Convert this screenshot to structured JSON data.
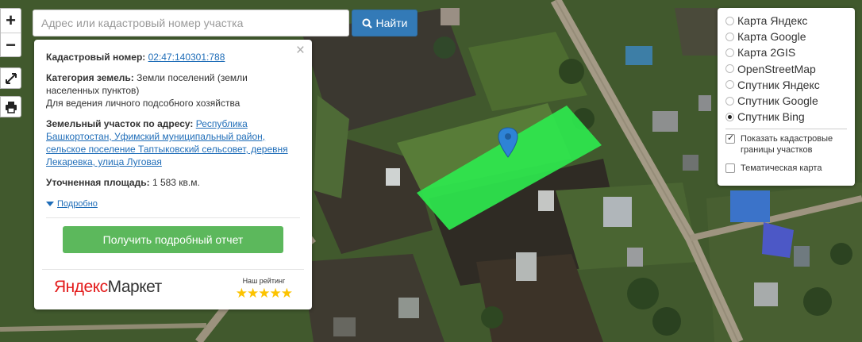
{
  "map": {
    "marker": "map-marker-icon",
    "plot_color": "#2ee84e"
  },
  "controls": {
    "zoom_in": "+",
    "zoom_out": "−",
    "fullscreen_icon": "fullscreen-icon",
    "print_icon": "print-icon"
  },
  "search": {
    "placeholder": "Адрес или кадастровый номер участка",
    "button_label": "Найти",
    "button_icon": "search-icon"
  },
  "info": {
    "cadastral_label": "Кадастровый номер:",
    "cadastral_number": "02:47:140301:788",
    "category_label": "Категория земель:",
    "category_value": "Земли поселений (земли населенных пунктов)",
    "usage": "Для ведения личного подсобного хозяйства",
    "address_label": "Земельный участок по адресу:",
    "address_value": "Республика Башкортостан, Уфимский муниципальный район, сельское поселение Таптыковский сельсовет, деревня Лекаревка, улица Луговая",
    "area_label": "Уточненная площадь:",
    "area_value": "1 583 кв.м.",
    "details_link": "Подробно",
    "report_button": "Получить подробный отчет",
    "market_logo_ya": "Яндекс",
    "market_logo_rest": "Маркет",
    "rating_label": "Наш рейтинг",
    "rating_stars": "★★★★★",
    "rating_value": 5,
    "close": "×"
  },
  "layers": {
    "options": [
      {
        "label": "Карта Яндекс",
        "selected": false
      },
      {
        "label": "Карта Google",
        "selected": false
      },
      {
        "label": "Карта 2GIS",
        "selected": false
      },
      {
        "label": "OpenStreetMap",
        "selected": false
      },
      {
        "label": "Спутник Яндекс",
        "selected": false
      },
      {
        "label": "Спутник Google",
        "selected": false
      },
      {
        "label": "Спутник Bing",
        "selected": true
      }
    ],
    "checkboxes": [
      {
        "label": "Показать кадастровые границы участков",
        "checked": true
      },
      {
        "label": "Тематическая карта",
        "checked": false
      }
    ]
  }
}
